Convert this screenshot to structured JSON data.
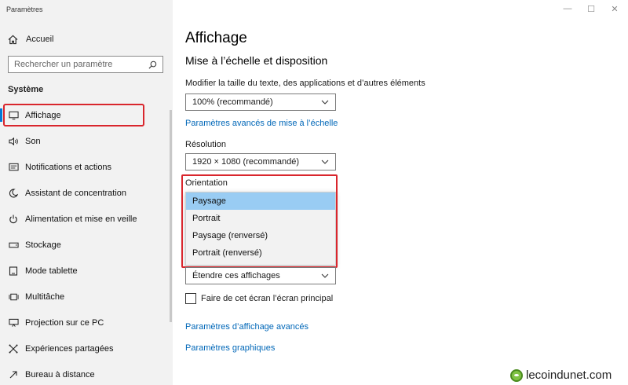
{
  "window": {
    "title": "Paramètres",
    "minimize": "—",
    "maximize": "☐",
    "close": "✕"
  },
  "sidebar": {
    "home_label": "Accueil",
    "search_placeholder": "Rechercher un paramètre",
    "section_label": "Système",
    "items": [
      {
        "label": "Affichage",
        "icon": "monitor-icon"
      },
      {
        "label": "Son",
        "icon": "speaker-icon"
      },
      {
        "label": "Notifications et actions",
        "icon": "notification-icon"
      },
      {
        "label": "Assistant de concentration",
        "icon": "moon-icon"
      },
      {
        "label": "Alimentation et mise en veille",
        "icon": "power-icon"
      },
      {
        "label": "Stockage",
        "icon": "storage-icon"
      },
      {
        "label": "Mode tablette",
        "icon": "tablet-icon"
      },
      {
        "label": "Multitâche",
        "icon": "multitask-icon"
      },
      {
        "label": "Projection sur ce PC",
        "icon": "projection-icon"
      },
      {
        "label": "Expériences partagées",
        "icon": "share-icon"
      },
      {
        "label": "Bureau à distance",
        "icon": "remote-icon"
      }
    ]
  },
  "main": {
    "title": "Affichage",
    "section_title": "Mise à l’échelle et disposition",
    "scale_label": "Modifier la taille du texte, des applications et d’autres éléments",
    "scale_value": "100% (recommandé)",
    "scale_link": "Paramètres avancés de mise à l’échelle",
    "resolution_label": "Résolution",
    "resolution_value": "1920 × 1080 (recommandé)",
    "orientation_label": "Orientation",
    "orientation_options": [
      "Paysage",
      "Portrait",
      "Paysage (renversé)",
      "Portrait (renversé)"
    ],
    "multi_display_value": "Étendre ces affichages",
    "main_display_checkbox": "Faire de cet écran l’écran principal",
    "advanced_link": "Paramètres d’affichage avancés",
    "graphics_link": "Paramètres graphiques"
  },
  "watermark": {
    "text": "lecoindunet.com"
  },
  "colors": {
    "accent": "#0078d7",
    "link": "#0067b8",
    "highlight": "#d9262d",
    "selected": "#99ccf3"
  }
}
